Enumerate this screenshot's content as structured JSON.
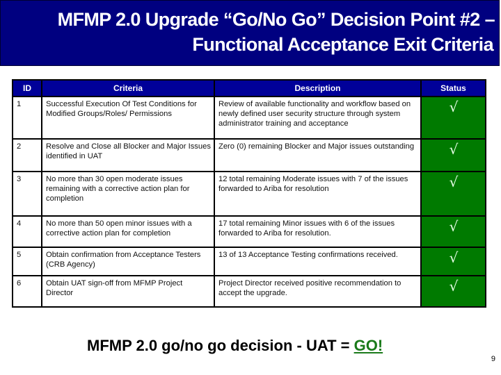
{
  "title": {
    "line1": "MFMP 2.0 Upgrade “Go/No Go” Decision Point #2 –",
    "line2": "Functional Acceptance Exit Criteria"
  },
  "table": {
    "headers": {
      "id": "ID",
      "criteria": "Criteria",
      "description": "Description",
      "status": "Status"
    },
    "rows": [
      {
        "id": "1",
        "criteria": "Successful Execution Of Test Conditions for Modified Groups/Roles/ Permissions",
        "description": "Review of available functionality and workflow based on newly defined user security structure through system administrator training and acceptance",
        "status": "√"
      },
      {
        "id": "2",
        "criteria": "Resolve and Close all Blocker and Major Issues identified in UAT",
        "description": "Zero (0) remaining Blocker and Major issues outstanding",
        "status": "√"
      },
      {
        "id": "3",
        "criteria": "No more than 30 open moderate issues remaining with a corrective action plan for completion",
        "description": "12 total remaining Moderate issues with 7 of the issues forwarded to Ariba for resolution",
        "status": "√"
      },
      {
        "id": "4",
        "criteria": "No more than 50 open minor issues with a corrective action plan for completion",
        "description": "17 total remaining Minor issues with 6 of the issues forwarded to Ariba for resolution.",
        "status": "√"
      },
      {
        "id": "5",
        "criteria": "Obtain confirmation from Acceptance Testers (CRB Agency)",
        "description": "13 of 13 Acceptance Testing confirmations received.",
        "status": "√"
      },
      {
        "id": "6",
        "criteria": "Obtain UAT sign-off from MFMP Project Director",
        "description": "Project Director received positive recommendation to accept the upgrade.",
        "status": "√"
      }
    ]
  },
  "footer": {
    "decision_text": "MFMP 2.0 go/no go decision - UAT = ",
    "decision_value": "GO!"
  },
  "page_number": "9",
  "colors": {
    "title_bg": "#000080",
    "header_bg": "#000099",
    "status_pass": "#007a00",
    "go_text": "#1a7a1a"
  }
}
